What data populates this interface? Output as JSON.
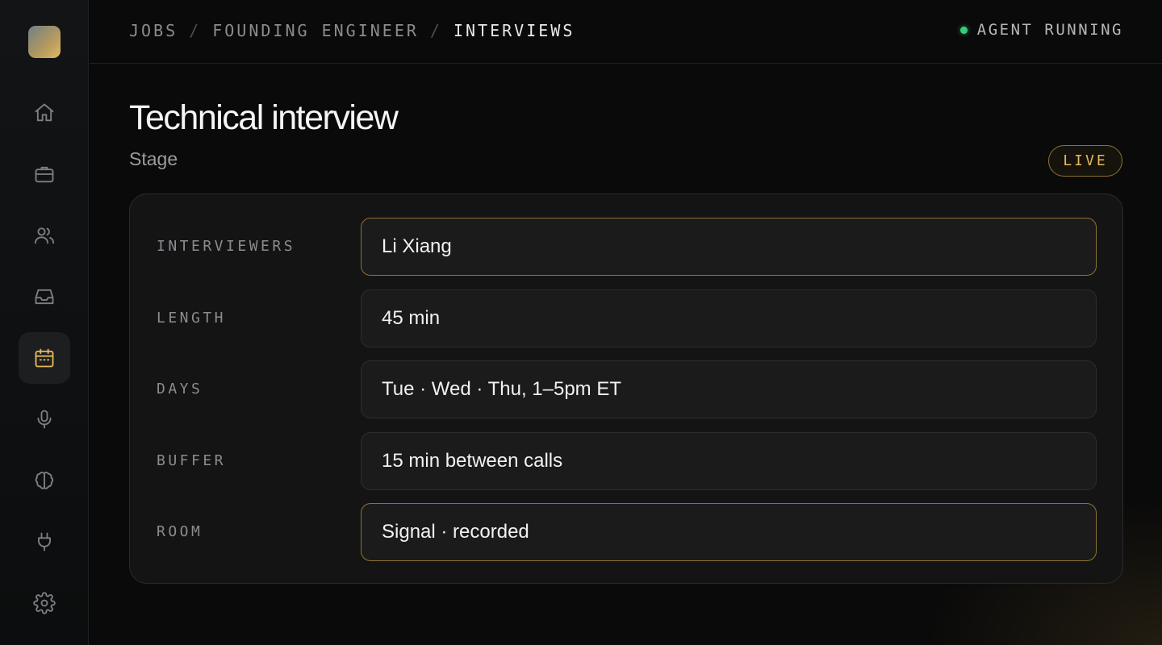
{
  "breadcrumb": {
    "items": [
      "JOBS",
      "FOUNDING ENGINEER",
      "INTERVIEWS"
    ],
    "separator": "/"
  },
  "status": {
    "label": "AGENT RUNNING",
    "color": "#2fd27a"
  },
  "sidebar": {
    "items": [
      {
        "icon": "home-icon",
        "active": false
      },
      {
        "icon": "briefcase-icon",
        "active": false
      },
      {
        "icon": "users-icon",
        "active": false
      },
      {
        "icon": "inbox-icon",
        "active": false
      },
      {
        "icon": "calendar-icon",
        "active": true
      },
      {
        "icon": "microphone-icon",
        "active": false
      },
      {
        "icon": "brain-icon",
        "active": false
      },
      {
        "icon": "plug-icon",
        "active": false
      },
      {
        "icon": "gear-icon",
        "active": false
      }
    ]
  },
  "page": {
    "title": "Technical interview",
    "subtitle": "Stage",
    "badge": "LIVE"
  },
  "form": {
    "fields": [
      {
        "label": "INTERVIEWERS",
        "value": "Li Xiang"
      },
      {
        "label": "LENGTH",
        "value": "45 min"
      },
      {
        "label": "DAYS",
        "value": "Tue · Wed · Thu, 1–5pm ET"
      },
      {
        "label": "BUFFER",
        "value": "15 min between calls"
      },
      {
        "label": "ROOM",
        "value": "Signal · recorded"
      }
    ]
  },
  "colors": {
    "accent": "#e3b85c",
    "background": "#0a0a0a"
  }
}
